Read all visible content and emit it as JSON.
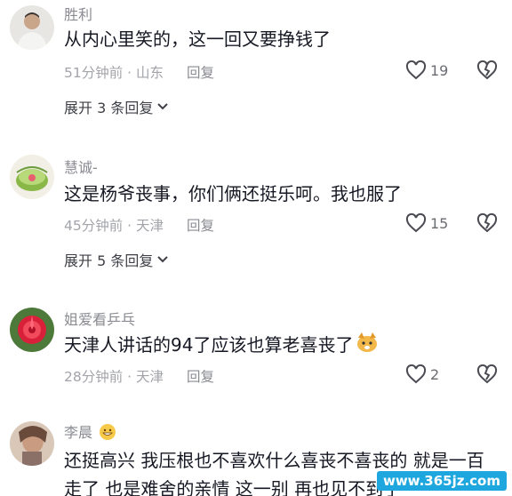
{
  "comments": [
    {
      "username": "胜利",
      "text": "从内心里笑的，这一回又要挣钱了",
      "time": "51分钟前 · 山东",
      "reply": "回复",
      "likes": "19",
      "expand": "展开 3 条回复"
    },
    {
      "username": "慧诚-",
      "text": "这是杨爷丧事，你们俩还挺乐呵。我也服了",
      "time": "45分钟前 · 天津",
      "reply": "回复",
      "likes": "15",
      "expand": "展开 5 条回复"
    },
    {
      "username": "姐爱看乒乓",
      "text": "天津人讲话的94了应该也算老喜丧了",
      "time": "28分钟前 · 天津",
      "reply": "回复",
      "likes": "2"
    },
    {
      "username": "李晨",
      "text": "还挺高兴 我压根也不喜欢什么喜丧不喜丧的 就是一百走了 也是难舍的亲情 这一别 再也见不到了"
    }
  ],
  "watermark": "www.365jz.com",
  "icons": {
    "like": "heart-outline-icon",
    "dislike": "broken-heart-icon",
    "expand": "chevron-down-icon",
    "emoji_smile": "grinning-emoji-icon",
    "emoji_dog": "dog-emoji-icon"
  }
}
